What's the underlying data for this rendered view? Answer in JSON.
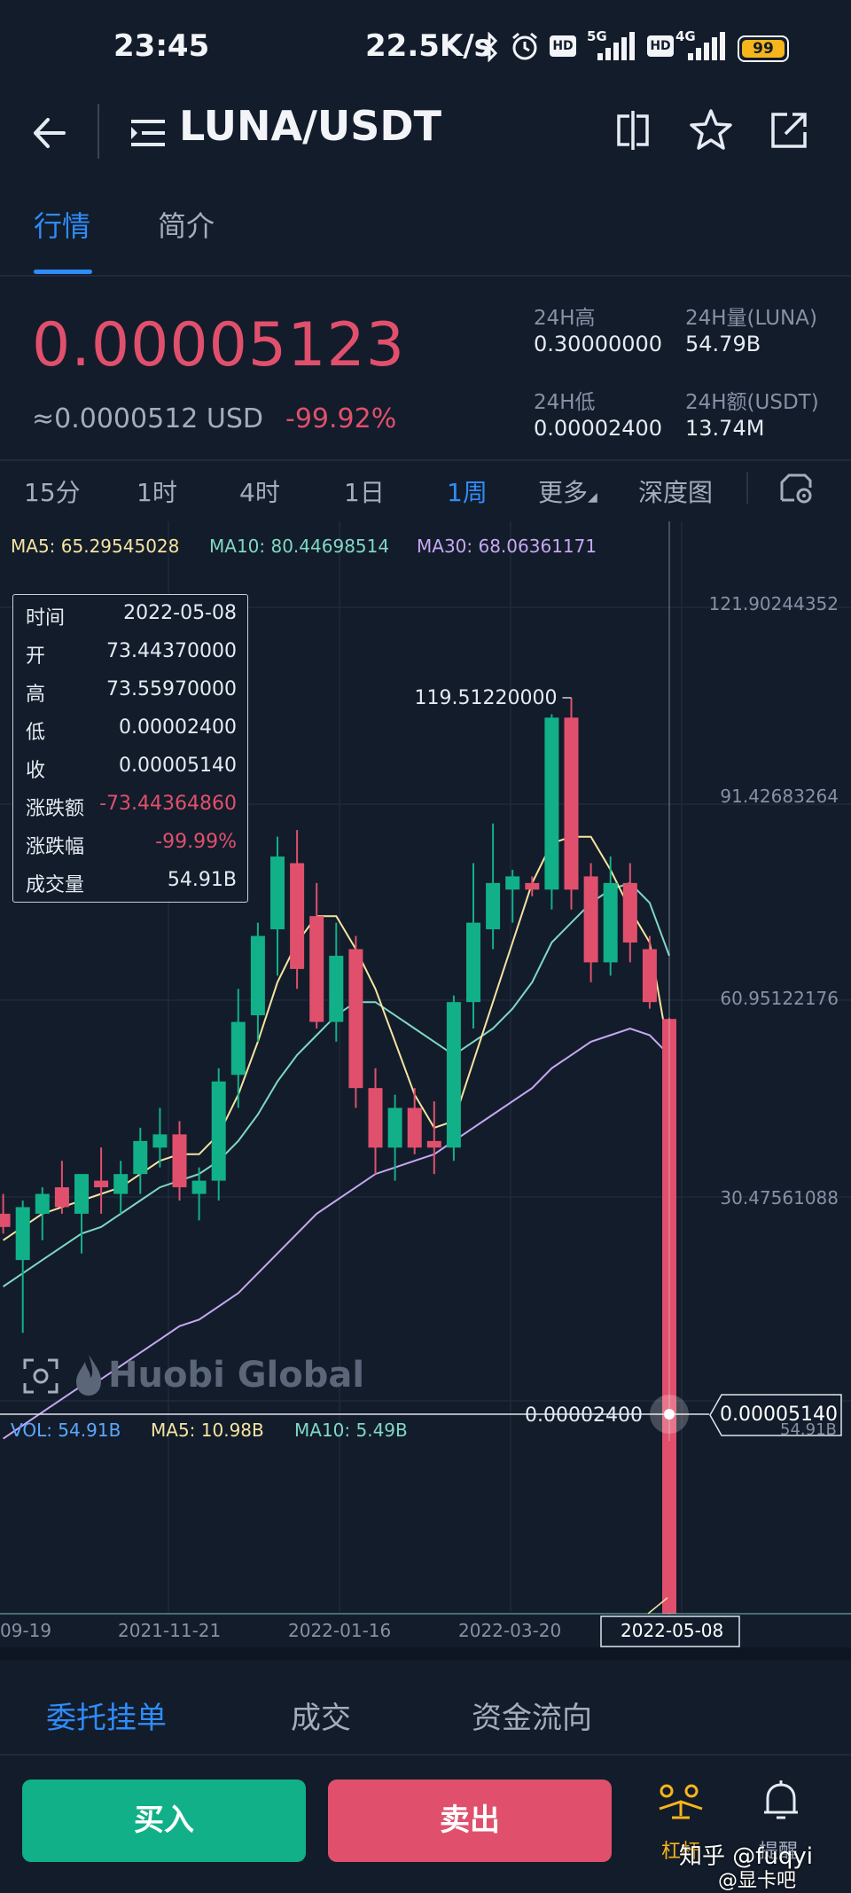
{
  "status_bar": {
    "time": "23:45",
    "network_speed": "22.5K/s",
    "signal_1": "5G",
    "signal_2": "4G",
    "hd_label": "HD",
    "battery": "99"
  },
  "header": {
    "pair": "LUNA/USDT",
    "icons": [
      "back-arrow-icon",
      "menu-list-icon",
      "split-screen-icon",
      "star-icon",
      "share-icon"
    ]
  },
  "tabs": [
    {
      "label": "行情",
      "active": true
    },
    {
      "label": "简介",
      "active": false
    }
  ],
  "ticker": {
    "price": "0.00005123",
    "usd_value": "≈0.0000512 USD",
    "change_pct": "-99.92%",
    "high_label": "24H高",
    "high_value": "0.30000000",
    "volume_label": "24H量(LUNA)",
    "volume_value": "54.79B",
    "low_label": "24H低",
    "low_value": "0.00002400",
    "amount_label": "24H额(USDT)",
    "amount_value": "13.74M"
  },
  "intervals": [
    {
      "label": "15分",
      "active": false
    },
    {
      "label": "1时",
      "active": false
    },
    {
      "label": "4时",
      "active": false
    },
    {
      "label": "1日",
      "active": false
    },
    {
      "label": "1周",
      "active": true
    },
    {
      "label": "更多",
      "active": false
    },
    {
      "label": "深度图",
      "active": false
    }
  ],
  "ma_legend": {
    "ma5": "MA5: 65.29545028",
    "ma10": "MA10: 80.44698514",
    "ma30": "MA30: 68.06361171"
  },
  "tooltip": {
    "rows": [
      {
        "k": "时间",
        "v": "2022-05-08"
      },
      {
        "k": "开",
        "v": "73.44370000"
      },
      {
        "k": "高",
        "v": "73.55970000"
      },
      {
        "k": "低",
        "v": "0.00002400"
      },
      {
        "k": "收",
        "v": "0.00005140"
      },
      {
        "k": "涨跌额",
        "v": "-73.44364860"
      },
      {
        "k": "涨跌幅",
        "v": "-99.99%"
      },
      {
        "k": "成交量",
        "v": "54.91B"
      }
    ]
  },
  "watermark": "Huobi Global",
  "vol_legend": {
    "vol": "VOL: 54.91B",
    "ma5": "MA5: 10.98B",
    "ma10": "MA10: 5.49B"
  },
  "crosshair": {
    "low_label": "0.00002400",
    "price_label": "0.00005140",
    "vol_axis_label": "54.91B"
  },
  "colors": {
    "up": "#11b088",
    "down": "#e0506c",
    "ma5": "#f5e4a0",
    "ma10": "#7fd8c4",
    "ma30": "#c6a8f2",
    "accent": "#2f8cf8"
  },
  "chart_data": {
    "type": "candlestick",
    "interval": "1周",
    "y_axis_ticks": [
      "121.90244352",
      "91.42683264",
      "60.95122176",
      "30.47561088"
    ],
    "x_axis_ticks": [
      "09-19",
      "2021-11-21",
      "2022-01-16",
      "2022-03-20",
      "2022-05-08"
    ],
    "max_label": "119.51220000",
    "ylim": [
      -17,
      135
    ],
    "candles": [
      {
        "o": 44,
        "h": 47,
        "l": 41,
        "c": 42
      },
      {
        "o": 37,
        "h": 46,
        "l": 26,
        "c": 45
      },
      {
        "o": 44,
        "h": 48,
        "l": 40,
        "c": 47
      },
      {
        "o": 48,
        "h": 52,
        "l": 44,
        "c": 45
      },
      {
        "o": 44,
        "h": 50,
        "l": 38,
        "c": 50
      },
      {
        "o": 49,
        "h": 54,
        "l": 44,
        "c": 48
      },
      {
        "o": 47,
        "h": 52,
        "l": 44,
        "c": 50
      },
      {
        "o": 50,
        "h": 57,
        "l": 47,
        "c": 55
      },
      {
        "o": 54,
        "h": 60,
        "l": 51,
        "c": 56
      },
      {
        "o": 56,
        "h": 58,
        "l": 46,
        "c": 48
      },
      {
        "o": 47,
        "h": 51,
        "l": 43,
        "c": 49
      },
      {
        "o": 49,
        "h": 66,
        "l": 46,
        "c": 64
      },
      {
        "o": 65,
        "h": 78,
        "l": 60,
        "c": 73
      },
      {
        "o": 74,
        "h": 88,
        "l": 70,
        "c": 86
      },
      {
        "o": 87,
        "h": 101,
        "l": 80,
        "c": 98
      },
      {
        "o": 97,
        "h": 102,
        "l": 78,
        "c": 81
      },
      {
        "o": 89,
        "h": 94,
        "l": 72,
        "c": 73
      },
      {
        "o": 73,
        "h": 88,
        "l": 70,
        "c": 83
      },
      {
        "o": 84,
        "h": 86,
        "l": 60,
        "c": 63
      },
      {
        "o": 63,
        "h": 66,
        "l": 50,
        "c": 54
      },
      {
        "o": 54,
        "h": 62,
        "l": 49,
        "c": 60
      },
      {
        "o": 60,
        "h": 63,
        "l": 53,
        "c": 54
      },
      {
        "o": 55,
        "h": 61,
        "l": 50,
        "c": 54
      },
      {
        "o": 54,
        "h": 77,
        "l": 52,
        "c": 76
      },
      {
        "o": 76,
        "h": 97,
        "l": 72,
        "c": 88
      },
      {
        "o": 87,
        "h": 103,
        "l": 84,
        "c": 94
      },
      {
        "o": 93,
        "h": 96,
        "l": 88,
        "c": 95
      },
      {
        "o": 94,
        "h": 95,
        "l": 92,
        "c": 93
      },
      {
        "o": 93,
        "h": 119.5,
        "l": 90,
        "c": 119
      },
      {
        "o": 119,
        "h": 122,
        "l": 90,
        "c": 93
      },
      {
        "o": 95,
        "h": 97,
        "l": 79,
        "c": 82
      },
      {
        "o": 82,
        "h": 98,
        "l": 80,
        "c": 94
      },
      {
        "o": 94,
        "h": 97,
        "l": 82,
        "c": 85
      },
      {
        "o": 84,
        "h": 86,
        "l": 75,
        "c": 76
      },
      {
        "o": 73.4437,
        "h": 73.5597,
        "l": 2.4e-05,
        "c": 5.14e-05
      }
    ],
    "ma5": [
      40,
      42,
      44,
      45,
      46,
      47,
      48,
      50,
      52,
      53,
      53,
      56,
      62,
      70,
      79,
      85,
      89,
      89,
      84,
      78,
      70,
      62,
      57,
      58,
      67,
      76,
      85,
      94,
      100,
      101,
      101,
      96,
      90,
      85,
      68
    ],
    "ma10": [
      33,
      35,
      37,
      39,
      41,
      42,
      44,
      46,
      48,
      49,
      50,
      52,
      55,
      59,
      64,
      68,
      71,
      74,
      76,
      76,
      74,
      72,
      70,
      68,
      70,
      72,
      75,
      79,
      85,
      88,
      91,
      93,
      94,
      91,
      83
    ],
    "ma30": [
      10,
      12,
      14,
      16,
      18,
      19,
      21,
      23,
      25,
      27,
      28,
      30,
      32,
      35,
      38,
      41,
      44,
      46,
      48,
      50,
      51,
      52,
      53,
      55,
      57,
      59,
      61,
      63,
      66,
      68,
      70,
      71,
      72,
      71,
      68
    ],
    "volume_max_label": "54.91B"
  },
  "bottom_tabs": [
    {
      "label": "委托挂单",
      "active": true
    },
    {
      "label": "成交",
      "active": false
    },
    {
      "label": "资金流向",
      "active": false
    }
  ],
  "actions": {
    "buy": "买入",
    "sell": "卖出"
  },
  "bottom_nav": {
    "lever_label": "杠杆",
    "alert_label": "提醒",
    "credit": "知乎 @fuqyi",
    "credit2": "@显卡吧"
  }
}
